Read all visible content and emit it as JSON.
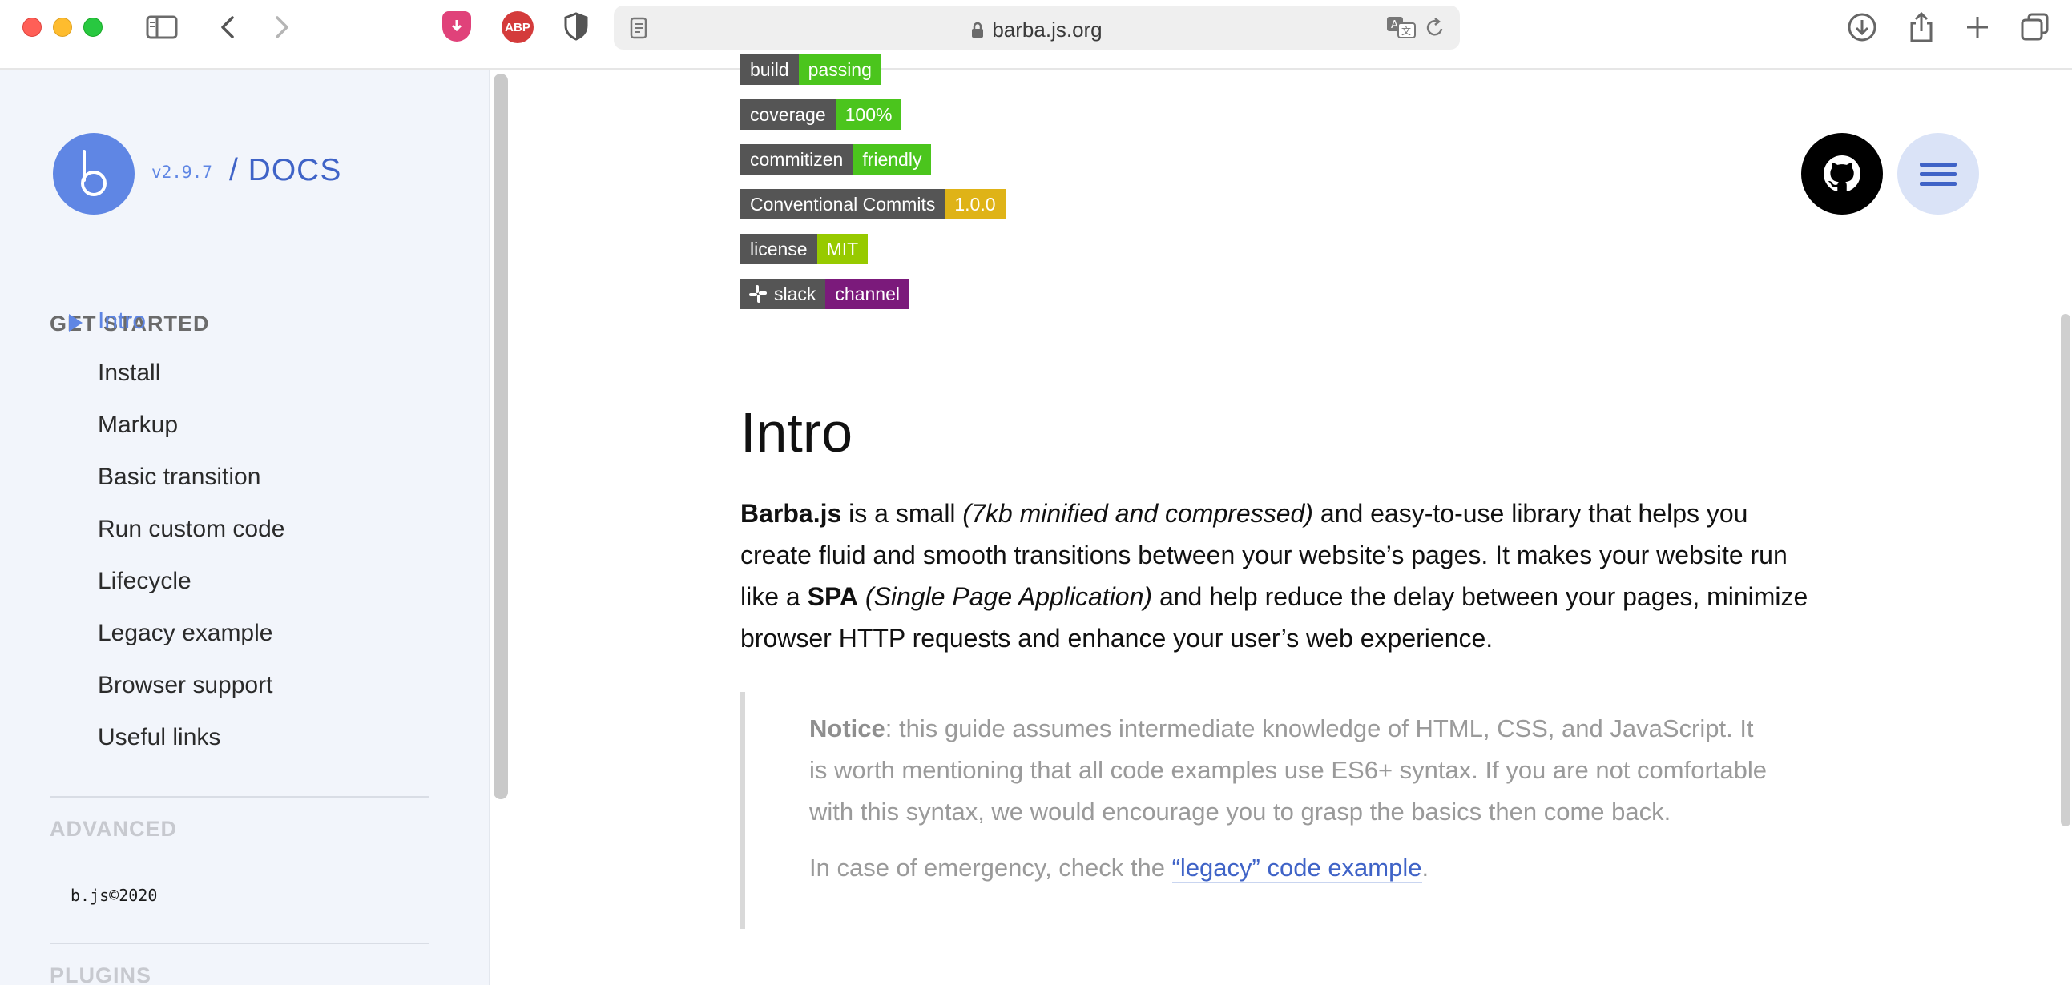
{
  "browser": {
    "url": "barba.js.org",
    "icons": [
      "sidebar-icon",
      "back-icon",
      "forward-icon",
      "ublock-icon",
      "adblock-icon",
      "privacy-icon",
      "reader-icon",
      "translate-icon",
      "reload-icon",
      "download-icon",
      "share-icon",
      "new-tab-icon",
      "tabs-overview-icon"
    ],
    "abp_label": "ABP"
  },
  "sidebar": {
    "version": "v2.9.7",
    "docs_label": "/ DOCS",
    "sections": [
      {
        "title": "GET STARTED"
      },
      {
        "title": "ADVANCED"
      },
      {
        "title": "PLUGINS"
      }
    ],
    "items": [
      {
        "label": "Intro",
        "active": true
      },
      {
        "label": "Install"
      },
      {
        "label": "Markup"
      },
      {
        "label": "Basic transition"
      },
      {
        "label": "Run custom code"
      },
      {
        "label": "Lifecycle"
      },
      {
        "label": "Legacy example"
      },
      {
        "label": "Browser support"
      },
      {
        "label": "Useful links"
      }
    ],
    "copyright": "b.js©2020"
  },
  "badges": [
    {
      "left": "build",
      "right": "passing",
      "color": "#4bc51d"
    },
    {
      "left": "coverage",
      "right": "100%",
      "color": "#4bc51d"
    },
    {
      "left": "commitizen",
      "right": "friendly",
      "color": "#4bc51d"
    },
    {
      "left": "Conventional Commits",
      "right": "1.0.0",
      "color": "#dfb317"
    },
    {
      "left": "license",
      "right": "MIT",
      "color": "#97ca00"
    },
    {
      "left": "slack",
      "right": "channel",
      "color": "#7b1a7b"
    }
  ],
  "content": {
    "title": "Intro",
    "p1": {
      "brand": "Barba.js",
      "t1": " is a small ",
      "em1": "(7kb minified and compressed)",
      "t2": " and easy-to-use library that helps you create fluid and smooth transitions between your website’s pages. It makes your website run like a ",
      "strong2": "SPA",
      "t3": " ",
      "em2": "(Single Page Application)",
      "t4": " and help reduce the delay between your pages, minimize browser HTTP requests and enhance your user’s web experience."
    },
    "notice": {
      "label": "Notice",
      "text": ": this guide assumes intermediate knowledge of HTML, CSS, and JavaScript. It is worth mentioning that all code examples use ES6+ syntax. If you are not comfortable with this syntax, we would encourage you to grasp the basics then come back.",
      "emergency_text": "In case of emergency, check the ",
      "link": "“legacy” code example",
      "end": "."
    }
  }
}
